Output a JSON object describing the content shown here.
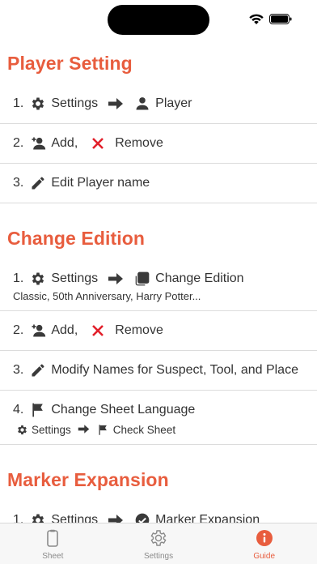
{
  "colors": {
    "accent": "#E85D3E",
    "remove": "#E2202B",
    "icon": "#3a3a3a",
    "inactive_tab": "#8a8a8a"
  },
  "sections": [
    {
      "title": "Player Setting",
      "rows": [
        {
          "num": "1.",
          "items": [
            {
              "icon": "gear-icon",
              "label": "Settings"
            },
            {
              "icon": "arrow-right-icon"
            },
            {
              "icon": "person-icon",
              "label": "Player"
            }
          ]
        },
        {
          "num": "2.",
          "items": [
            {
              "icon": "person-add-icon",
              "label": "Add,"
            },
            {
              "icon": "x-icon",
              "label": "Remove"
            }
          ]
        },
        {
          "num": "3.",
          "items": [
            {
              "icon": "pencil-icon",
              "label": "Edit Player name"
            }
          ]
        }
      ]
    },
    {
      "title": "Change Edition",
      "rows": [
        {
          "num": "1.",
          "items": [
            {
              "icon": "gear-icon",
              "label": "Settings"
            },
            {
              "icon": "arrow-right-icon"
            },
            {
              "icon": "copy-icon",
              "label": "Change Edition"
            }
          ],
          "sub": "Classic, 50th Anniversary, Harry Potter..."
        },
        {
          "num": "2.",
          "items": [
            {
              "icon": "person-add-icon",
              "label": "Add,"
            },
            {
              "icon": "x-icon",
              "label": "Remove"
            }
          ]
        },
        {
          "num": "3.",
          "items": [
            {
              "icon": "pencil-icon",
              "label": "Modify Names for Suspect, Tool, and Place"
            }
          ]
        },
        {
          "num": "4.",
          "items": [
            {
              "icon": "flag-icon",
              "label": "Change Sheet Language"
            }
          ],
          "subline": {
            "a": "Settings",
            "b": "Check Sheet"
          }
        }
      ]
    },
    {
      "title": "Marker Expansion",
      "rows": [
        {
          "num": "1.",
          "items": [
            {
              "icon": "gear-icon",
              "label": "Settings"
            },
            {
              "icon": "arrow-right-icon"
            },
            {
              "icon": "check-circle-icon",
              "label": "Marker Expansion"
            }
          ]
        }
      ]
    }
  ],
  "tabs": [
    {
      "label": "Sheet",
      "icon": "sheet-icon",
      "active": false
    },
    {
      "label": "Settings",
      "icon": "gear-icon",
      "active": false
    },
    {
      "label": "Guide",
      "icon": "info-icon",
      "active": true
    }
  ]
}
